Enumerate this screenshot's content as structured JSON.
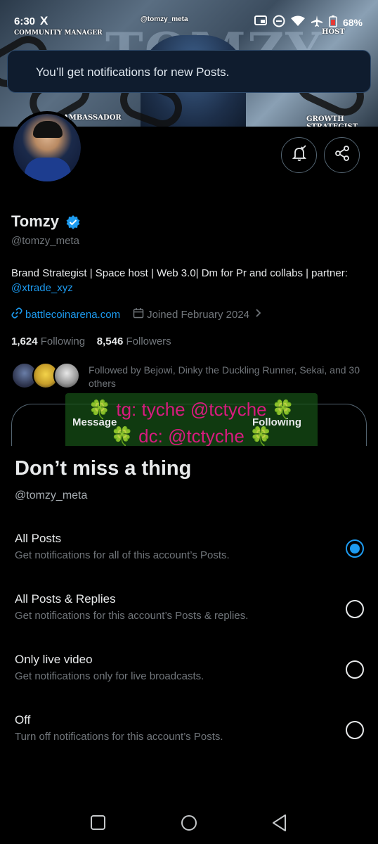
{
  "status_bar": {
    "time": "6:30",
    "app_icon": "X",
    "battery": "68%",
    "icons": [
      "cast-icon",
      "dnd-icon",
      "wifi-icon",
      "airplane-icon",
      "battery-icon"
    ]
  },
  "banner": {
    "handle": "@tomzy_meta",
    "big_text": "TOMZY",
    "tag_community": "COMMUNITY MANAGER",
    "tag_host": "HOST",
    "tag_ambassador": "AMBASSADOR",
    "tag_growth": "GROWTH STRATEGIST"
  },
  "toast": {
    "text": "You’ll get notifications for new Posts."
  },
  "profile": {
    "name": "Tomzy",
    "handle": "@tomzy_meta",
    "bio_text": "Brand Strategist | Space host | Web 3.0| Dm for Pr and collabs | partner: ",
    "bio_mention": "@xtrade_xyz",
    "link": "battlecoinarena.com",
    "joined": "Joined February 2024",
    "following_count": "1,624",
    "following_label": "Following",
    "followers_count": "8,546",
    "followers_label": "Followers",
    "followed_by": "Followed by Bejowi, Dinky the Duckling Runner, Sekai, and 30 others"
  },
  "promo": {
    "line1": "🍀 tg: tyche @tctyche 🍀",
    "line2": "🍀 dc: @tctyche 🍀",
    "message_label": "Message",
    "following_label": "Following"
  },
  "sheet": {
    "title": "Don’t miss a thing",
    "subtitle": "@tomzy_meta",
    "options": [
      {
        "title": "All Posts",
        "desc": "Get notifications for all of this account’s Posts.",
        "selected": true
      },
      {
        "title": "All Posts & Replies",
        "desc": "Get notifications for this account’s Posts & replies.",
        "selected": false
      },
      {
        "title": "Only live video",
        "desc": "Get notifications only for live broadcasts.",
        "selected": false
      },
      {
        "title": "Off",
        "desc": "Turn off notifications for this account’s Posts.",
        "selected": false
      }
    ]
  },
  "colors": {
    "accent": "#1d9bf0",
    "background": "#000000",
    "muted": "#71767b",
    "promo_text": "#d81b7f"
  }
}
